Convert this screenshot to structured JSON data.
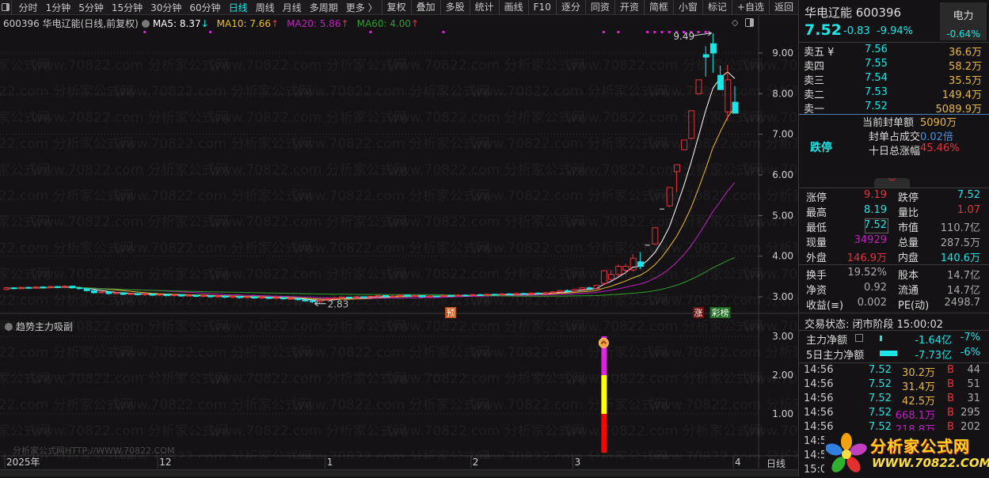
{
  "toolbar": {
    "left_items": [
      "分时",
      "1分钟",
      "5分钟",
      "15分钟",
      "30分钟",
      "60分钟",
      "日线",
      "周线",
      "月线",
      "多周期",
      "更多 〉"
    ],
    "active": "日线",
    "right_items": [
      "复权",
      "叠加",
      "多股",
      "统计",
      "画线",
      "F10",
      "逐分",
      "同资",
      "开资",
      "简框",
      "小窗",
      "标记",
      "+自选",
      "返回"
    ]
  },
  "chart_header": {
    "title": "600396 华电辽能(日线,前复权)",
    "ma5": "MA5: 8.37",
    "ma10": "MA10: 7.66",
    "ma20": "MA20: 5.86",
    "ma60": "MA60: 4.00",
    "ma5_arrow": "↓",
    "ma10_arrow": "↑",
    "ma20_arrow": "↑",
    "ma60_arrow": "↑"
  },
  "colors": {
    "up": "#e8323c",
    "down": "#1ee5e5",
    "ma5": "#ffffff",
    "ma10": "#e6c02c",
    "ma20": "#c020c0",
    "ma60": "#2ca02c",
    "signal": "#e020e0"
  },
  "chart_data": [
    {
      "type": "candlestick",
      "title": "600396 华电辽能(日线,前复权)",
      "ylim": [
        2.6,
        9.6
      ],
      "yticks": [
        "9.00",
        "8.00",
        "7.00",
        "6.00",
        "5.00",
        "4.00",
        "3.00"
      ],
      "ohlc": [
        [
          3.18,
          3.22,
          3.24,
          3.16
        ],
        [
          3.22,
          3.2,
          3.24,
          3.18
        ],
        [
          3.2,
          3.23,
          3.25,
          3.19
        ],
        [
          3.23,
          3.21,
          3.25,
          3.19
        ],
        [
          3.21,
          3.24,
          3.26,
          3.2
        ],
        [
          3.24,
          3.22,
          3.26,
          3.2
        ],
        [
          3.22,
          3.25,
          3.27,
          3.21
        ],
        [
          3.25,
          3.23,
          3.27,
          3.21
        ],
        [
          3.23,
          3.26,
          3.28,
          3.22
        ],
        [
          3.26,
          3.22,
          3.27,
          3.2
        ],
        [
          3.22,
          3.2,
          3.24,
          3.18
        ],
        [
          3.2,
          3.15,
          3.21,
          3.13
        ],
        [
          3.15,
          3.1,
          3.16,
          3.08
        ],
        [
          3.1,
          3.12,
          3.14,
          3.08
        ],
        [
          3.12,
          3.08,
          3.13,
          3.05
        ],
        [
          3.08,
          3.1,
          3.12,
          3.06
        ],
        [
          3.1,
          3.06,
          3.11,
          3.04
        ],
        [
          3.06,
          3.08,
          3.1,
          3.04
        ],
        [
          3.08,
          3.05,
          3.09,
          3.03
        ],
        [
          3.05,
          3.07,
          3.09,
          3.03
        ],
        [
          3.07,
          3.04,
          3.08,
          3.02
        ],
        [
          3.04,
          3.06,
          3.08,
          3.02
        ],
        [
          3.06,
          3.03,
          3.07,
          3.01
        ],
        [
          3.03,
          3.05,
          3.07,
          3.01
        ],
        [
          3.05,
          3.02,
          3.06,
          3.0
        ],
        [
          3.02,
          3.04,
          3.06,
          3.0
        ],
        [
          3.04,
          3.01,
          3.05,
          2.99
        ],
        [
          3.01,
          3.03,
          3.05,
          2.99
        ],
        [
          3.03,
          3.0,
          3.04,
          2.98
        ],
        [
          3.0,
          3.02,
          3.04,
          2.98
        ],
        [
          3.02,
          2.99,
          3.03,
          2.97
        ],
        [
          2.99,
          3.01,
          3.03,
          2.97
        ],
        [
          3.01,
          2.98,
          3.02,
          2.96
        ],
        [
          2.98,
          3.0,
          3.02,
          2.96
        ],
        [
          3.0,
          2.97,
          3.01,
          2.95
        ],
        [
          2.97,
          2.99,
          3.01,
          2.95
        ],
        [
          2.99,
          2.96,
          3.0,
          2.94
        ],
        [
          2.96,
          2.98,
          3.0,
          2.94
        ],
        [
          2.98,
          2.95,
          2.99,
          2.93
        ],
        [
          2.95,
          2.96,
          2.98,
          2.92
        ],
        [
          2.96,
          2.93,
          2.97,
          2.9
        ],
        [
          2.93,
          2.9,
          2.94,
          2.88
        ],
        [
          2.9,
          2.88,
          2.92,
          2.85
        ],
        [
          2.88,
          2.92,
          2.93,
          2.83
        ],
        [
          2.92,
          2.95,
          2.97,
          2.9
        ],
        [
          2.95,
          2.97,
          2.99,
          2.93
        ],
        [
          2.97,
          2.99,
          3.01,
          2.95
        ],
        [
          2.99,
          2.97,
          3.0,
          2.95
        ],
        [
          2.97,
          3.0,
          3.02,
          2.96
        ],
        [
          3.0,
          2.98,
          3.01,
          2.96
        ],
        [
          2.98,
          3.01,
          3.03,
          2.97
        ],
        [
          3.01,
          3.03,
          3.05,
          2.99
        ],
        [
          3.03,
          3.0,
          3.04,
          2.98
        ],
        [
          3.0,
          3.02,
          3.04,
          2.99
        ],
        [
          3.02,
          3.04,
          3.06,
          3.0
        ],
        [
          3.04,
          3.01,
          3.05,
          2.99
        ],
        [
          3.01,
          3.03,
          3.05,
          3.0
        ],
        [
          3.03,
          3.0,
          3.04,
          2.98
        ],
        [
          3.0,
          3.02,
          3.03,
          2.99
        ],
        [
          3.02,
          3.01,
          3.03,
          2.99
        ],
        [
          3.01,
          3.03,
          3.05,
          3.0
        ],
        [
          3.03,
          3.02,
          3.05,
          3.0
        ],
        [
          3.02,
          3.04,
          3.06,
          3.01
        ],
        [
          3.04,
          3.03,
          3.06,
          3.01
        ],
        [
          3.03,
          3.05,
          3.07,
          3.02
        ],
        [
          3.05,
          3.04,
          3.07,
          3.02
        ],
        [
          3.04,
          3.06,
          3.08,
          3.03
        ],
        [
          3.06,
          3.05,
          3.08,
          3.03
        ],
        [
          3.05,
          3.07,
          3.09,
          3.04
        ],
        [
          3.07,
          3.06,
          3.09,
          3.04
        ],
        [
          3.06,
          3.08,
          3.1,
          3.05
        ],
        [
          3.08,
          3.07,
          3.1,
          3.05
        ],
        [
          3.07,
          3.09,
          3.11,
          3.06
        ],
        [
          3.09,
          3.08,
          3.11,
          3.06
        ],
        [
          3.08,
          3.1,
          3.12,
          3.07
        ],
        [
          3.1,
          3.12,
          3.14,
          3.08
        ],
        [
          3.12,
          3.15,
          3.17,
          3.1
        ],
        [
          3.15,
          3.14,
          3.18,
          3.12
        ],
        [
          3.14,
          3.18,
          3.2,
          3.13
        ],
        [
          3.18,
          3.22,
          3.24,
          3.16
        ],
        [
          3.22,
          3.2,
          3.25,
          3.18
        ],
        [
          3.2,
          3.28,
          3.3,
          3.19
        ],
        [
          3.33,
          3.64,
          3.65,
          3.28
        ],
        [
          3.43,
          3.55,
          3.66,
          3.4
        ],
        [
          3.55,
          3.75,
          3.8,
          3.5
        ],
        [
          3.65,
          3.75,
          3.82,
          3.55
        ],
        [
          3.66,
          3.95,
          4.05,
          3.62
        ],
        [
          3.86,
          3.75,
          4.1,
          3.68
        ],
        [
          4.27,
          4.27,
          4.27,
          4.27
        ],
        [
          4.3,
          4.7,
          4.7,
          4.28
        ],
        [
          5.16,
          5.16,
          5.16,
          5.16
        ],
        [
          5.24,
          5.69,
          5.69,
          5.2
        ],
        [
          6.08,
          6.25,
          6.25,
          5.57
        ],
        [
          6.62,
          6.86,
          6.86,
          6.6
        ],
        [
          6.9,
          7.58,
          7.58,
          6.88
        ],
        [
          8.0,
          8.34,
          8.34,
          7.98
        ],
        [
          8.96,
          8.9,
          9.17,
          8.42
        ],
        [
          9.23,
          9.0,
          9.49,
          8.51
        ],
        [
          8.45,
          8.1,
          8.69,
          8.1
        ],
        [
          7.55,
          8.34,
          8.71,
          7.33
        ],
        [
          7.79,
          7.52,
          8.19,
          7.52
        ]
      ],
      "ma_periods": [
        5,
        10,
        20,
        60
      ],
      "signal_dots": [
        19,
        28,
        50,
        60,
        82,
        84,
        88,
        89,
        90,
        91,
        92,
        93,
        94,
        95,
        96
      ],
      "annotations": {
        "high": "9.49",
        "low": "2.83",
        "high_index": 97,
        "low_index": 43
      },
      "event_markers": [
        {
          "label": "预",
          "index": 61,
          "color": "#c8561a"
        },
        {
          "label": "涨",
          "index": 95,
          "color": "#6a1010"
        },
        {
          "label": "彩榜",
          "index": 98,
          "color": "#1f6a1f"
        }
      ],
      "x_labels": [
        {
          "label": "2025年",
          "index": 0
        },
        {
          "label": "12",
          "index": 21
        },
        {
          "label": "1",
          "index": 44
        },
        {
          "label": "2",
          "index": 64
        },
        {
          "label": "3",
          "index": 78
        },
        {
          "label": "4",
          "index": 100
        }
      ],
      "period_label": "日线"
    },
    {
      "type": "stacked_bar",
      "title": "趋势主力吸副",
      "ylim": [
        0,
        3.2
      ],
      "yticks": [
        "3.00",
        "2.00",
        "1.00"
      ],
      "bar_index": 82,
      "segments": [
        {
          "from": 0,
          "to": 1,
          "color": "#ff0000"
        },
        {
          "from": 1,
          "to": 2,
          "color": "#ffff00"
        },
        {
          "from": 2,
          "to": 3,
          "color": "#e020e0"
        }
      ]
    }
  ],
  "watermark": "www.70822.com 分析家公式网",
  "indicator_watermark": "分析家公式网HTTP://WWW.70822.COM",
  "quote": {
    "name_code": "华电辽能 600396",
    "sector": "电力",
    "sector_change": "-0.64%",
    "price": "7.52",
    "change": "-0.83",
    "change_pct": "-9.94%"
  },
  "asks": [
    {
      "label": "卖五 ¥",
      "price": "7.56",
      "vol": "36.6万"
    },
    {
      "label": "卖四",
      "price": "7.55",
      "vol": "58.2万"
    },
    {
      "label": "卖三",
      "price": "7.54",
      "vol": "35.5万"
    },
    {
      "label": "卖二",
      "price": "7.53",
      "vol": "149.4万"
    },
    {
      "label": "卖一",
      "price": "7.52",
      "vol": "5089.9万"
    }
  ],
  "limit": {
    "status": "跌停",
    "seal_label": "当前封单额",
    "seal_value": "5090万",
    "ratio_label": "封单占成交",
    "ratio_value": "0.02倍",
    "ten_day_label": "十日总涨幅",
    "ten_day_value": "45.46%"
  },
  "stats": [
    {
      "l1": "涨停",
      "v1": "9.19",
      "c1": "rd",
      "l2": "跌停",
      "v2": "7.52",
      "c2": "cy"
    },
    {
      "l1": "最高",
      "v1": "8.19",
      "c1": "cy",
      "l2": "量比",
      "v2": "1.07",
      "c2": "rd"
    },
    {
      "l1": "最低",
      "v1": "7.52",
      "c1": "cy",
      "l2": "市值",
      "v2": "110.7亿",
      "c2": "gy"
    },
    {
      "l1": "现量",
      "v1": "34929",
      "c1": "mg",
      "l2": "总量",
      "v2": "287.5万",
      "c2": "gy"
    },
    {
      "l1": "外盘",
      "v1": "146.9万",
      "c1": "rd",
      "l2": "内盘",
      "v2": "140.6万",
      "c2": "cy"
    }
  ],
  "stats2": [
    {
      "l1": "换手",
      "v1": "19.52%",
      "l2": "股本",
      "v2": "14.7亿"
    },
    {
      "l1": "净资",
      "v1": "0.92",
      "l2": "流通",
      "v2": "14.7亿"
    },
    {
      "l1": "收益(≡)",
      "v1": "0.002",
      "l2": "PE(动)",
      "v2": "2498.7"
    }
  ],
  "trade_status": "交易状态: 闭市阶段 15:00:02",
  "flows": [
    {
      "label": "主力净额",
      "value": "-1.64亿",
      "pct": "-7%",
      "bar": 0.15
    },
    {
      "label": "5日主力净额",
      "value": "-7.73亿",
      "pct": "-6%",
      "bar": 1.0
    }
  ],
  "ticks": [
    {
      "time": "14:56",
      "price": "7.52",
      "vol": "30.2万",
      "side": "B",
      "count": "44",
      "big": false
    },
    {
      "time": "14:56",
      "price": "7.52",
      "vol": "31.4万",
      "side": "B",
      "count": "51",
      "big": false
    },
    {
      "time": "14:56",
      "price": "7.52",
      "vol": "42.5万",
      "side": "B",
      "count": "31",
      "big": false
    },
    {
      "time": "14:56",
      "price": "7.52",
      "vol": "668.1万",
      "side": "B",
      "count": "295",
      "big": true
    },
    {
      "time": "14:56",
      "price": "7.52",
      "vol": "218.8万",
      "side": "B",
      "count": "202",
      "big": true
    },
    {
      "time": "14:56",
      "price": "",
      "vol": "",
      "side": "",
      "count": "",
      "big": false
    },
    {
      "time": "14:5",
      "price": "",
      "vol": "",
      "side": "",
      "count": "",
      "big": false
    },
    {
      "time": "15:0",
      "price": "",
      "vol": "",
      "side": "",
      "count": "",
      "big": false
    }
  ],
  "logo": {
    "title": "分析家公式网",
    "url": "WWW.70822.COM"
  }
}
